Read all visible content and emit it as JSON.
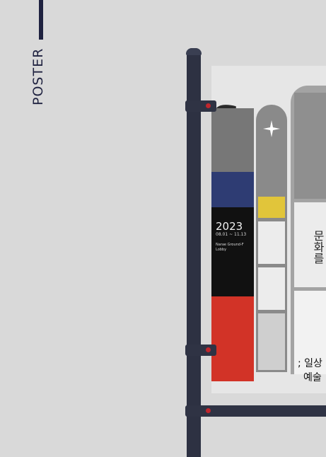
{
  "sidebar": {
    "label": "POSTER"
  },
  "poster": {
    "year": "2023",
    "dates": "08.01 ~ 11.13",
    "venue": "Narae Ground-F Lobby",
    "headline_kr": "문화를",
    "sub_kr_1": "; 일상",
    "sub_kr_2": "예술"
  },
  "colors": {
    "pole": "#2d3142",
    "accent_dot": "#c0262d",
    "blue": "#2e3c73",
    "red": "#d23327",
    "yellow": "#e1c53a"
  },
  "icons": [
    "sparkle-icon"
  ]
}
